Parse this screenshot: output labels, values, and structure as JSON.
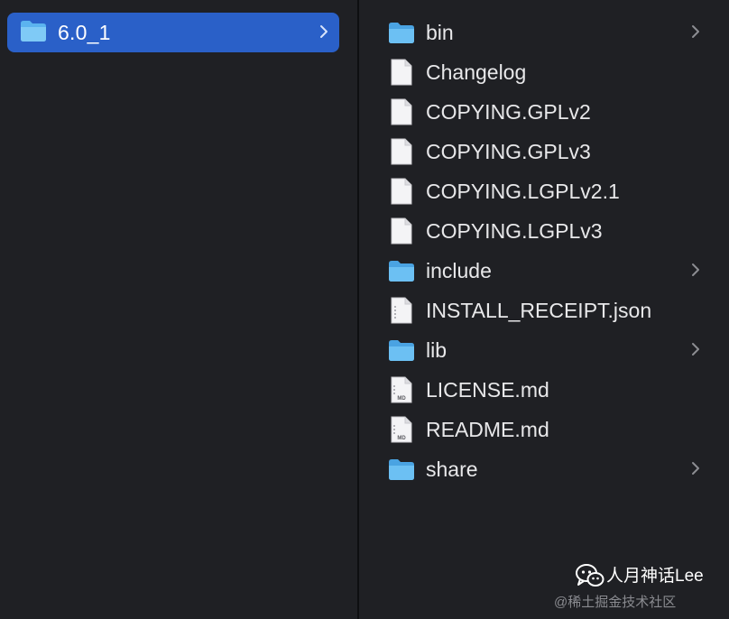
{
  "left_column": {
    "selected_folder": {
      "label": "6.0_1",
      "icon": "folder-icon",
      "has_children": true
    }
  },
  "right_column": {
    "items": [
      {
        "name": "bin",
        "kind": "folder",
        "icon": "folder-icon",
        "has_children": true
      },
      {
        "name": "Changelog",
        "kind": "file",
        "icon": "document-icon",
        "has_children": false
      },
      {
        "name": "COPYING.GPLv2",
        "kind": "file",
        "icon": "document-icon",
        "has_children": false
      },
      {
        "name": "COPYING.GPLv3",
        "kind": "file",
        "icon": "document-icon",
        "has_children": false
      },
      {
        "name": "COPYING.LGPLv2.1",
        "kind": "file",
        "icon": "document-icon",
        "has_children": false
      },
      {
        "name": "COPYING.LGPLv3",
        "kind": "file",
        "icon": "document-icon",
        "has_children": false
      },
      {
        "name": "include",
        "kind": "folder",
        "icon": "folder-icon",
        "has_children": true
      },
      {
        "name": "INSTALL_RECEIPT.json",
        "kind": "json",
        "icon": "json-file-icon",
        "has_children": false
      },
      {
        "name": "lib",
        "kind": "folder",
        "icon": "folder-icon",
        "has_children": true
      },
      {
        "name": "LICENSE.md",
        "kind": "md",
        "icon": "markdown-file-icon",
        "has_children": false,
        "badge": "MD"
      },
      {
        "name": "README.md",
        "kind": "md",
        "icon": "markdown-file-icon",
        "has_children": false,
        "badge": "MD"
      },
      {
        "name": "share",
        "kind": "folder",
        "icon": "folder-icon",
        "has_children": true
      }
    ]
  },
  "watermark": {
    "brand": "人月神话Lee",
    "site": "@稀土掘金技术社区",
    "logo_icon": "wechat-icon"
  },
  "colors": {
    "background": "#1f2024",
    "selection": "#2a60c8",
    "folder_blue": "#5bb3ef",
    "text": "#e8e8ea",
    "chevron": "#8c8d92"
  }
}
